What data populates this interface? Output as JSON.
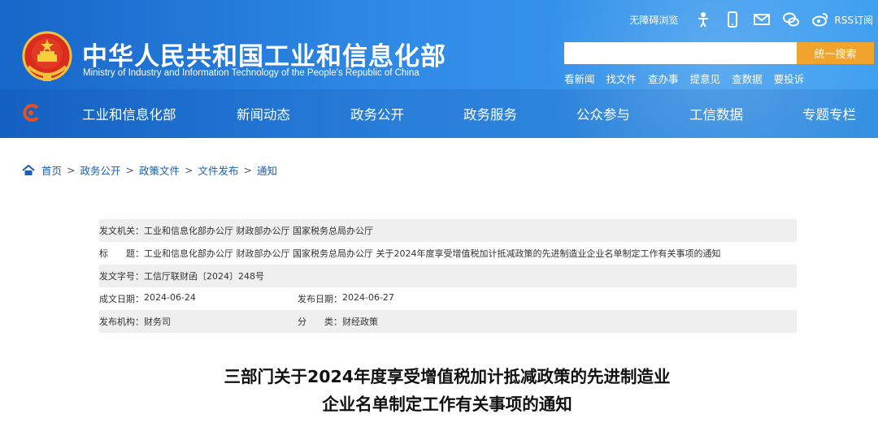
{
  "header": {
    "site_title": "中华人民共和国工业和信息化部",
    "site_subtitle": "Ministry of Industry and Information Technology of the People's Republic of China",
    "accessibility_label": "无障碍浏览",
    "rss_label": "RSS订阅",
    "search": {
      "placeholder": "",
      "button_label": "统一搜索"
    },
    "quick_links": [
      "看新闻",
      "找文件",
      "查办事",
      "提意见",
      "查数据",
      "要投诉"
    ]
  },
  "nav": {
    "items": [
      "工业和信息化部",
      "新闻动态",
      "政务公开",
      "政务服务",
      "公众参与",
      "工信数据",
      "专题专栏"
    ]
  },
  "breadcrumb": [
    "首页",
    "政务公开",
    "政策文件",
    "文件发布",
    "通知"
  ],
  "info": {
    "issuer_label": "发文机关：",
    "issuer_value": "工业和信息化部办公厅 财政部办公厅 国家税务总局办公厅",
    "title_label": "标　　题：",
    "title_value": "工业和信息化部办公厅 财政部办公厅 国家税务总局办公厅 关于2024年度享受增值税加计抵减政策的先进制造业企业名单制定工作有关事项的通知",
    "docno_label": "发文字号：",
    "docno_value": "工信厅联财函〔2024〕248号",
    "created_label": "成文日期：",
    "created_value": "2024-06-24",
    "published_label": "发布日期：",
    "published_value": "2024-06-27",
    "org_label": "发布机构：",
    "org_value": "财务司",
    "category_label": "分　　类：",
    "category_value": "财经政策"
  },
  "document": {
    "title_line1": "三部门关于2024年度享受增值税加计抵减政策的先进制造业",
    "title_line2": "企业名单制定工作有关事项的通知"
  },
  "colors": {
    "header_blue": "#2f8ae6",
    "search_button": "#f0a42e",
    "link_blue": "#1a5fb4"
  },
  "icons": [
    "national-emblem",
    "accessibility-icon",
    "mobile-icon",
    "mail-icon",
    "wechat-icon",
    "weibo-icon",
    "rss-icon",
    "nav-logo-icon",
    "home-icon"
  ]
}
